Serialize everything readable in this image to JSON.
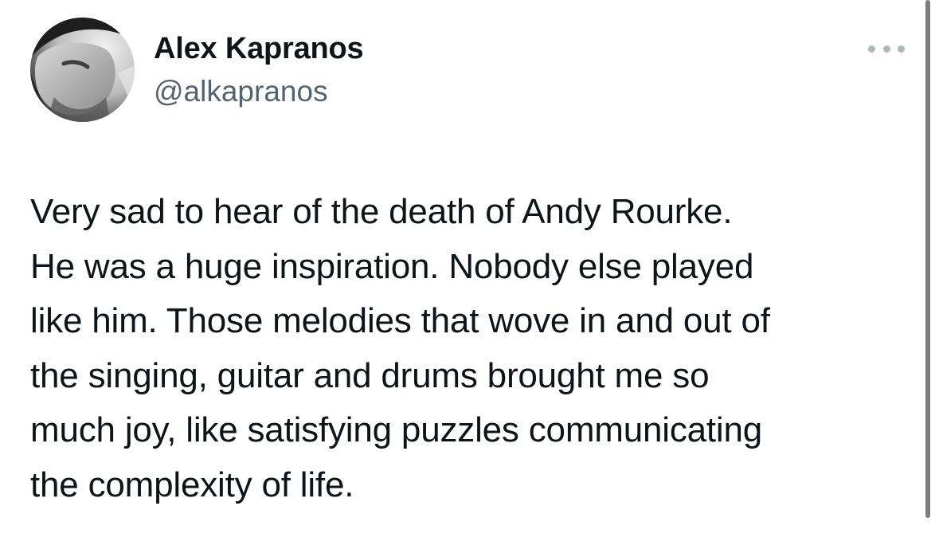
{
  "author": {
    "display_name": "Alex Kapranos",
    "handle": "@alkapranos",
    "avatar_icon": "profile-photo"
  },
  "menu": {
    "icon": "more-options-icon"
  },
  "tweet": {
    "text": "Very sad to hear of the death of Andy Rourke.\nHe was a huge inspiration. Nobody else played\nlike him. Those melodies that wove in and out of\nthe singing, guitar and drums brought me so\nmuch joy, like satisfying puzzles communicating\nthe complexity of life."
  },
  "colors": {
    "text": "#0f1419",
    "secondary_text": "#536471",
    "background": "#ffffff",
    "menu_dots": "#aab8c2"
  }
}
